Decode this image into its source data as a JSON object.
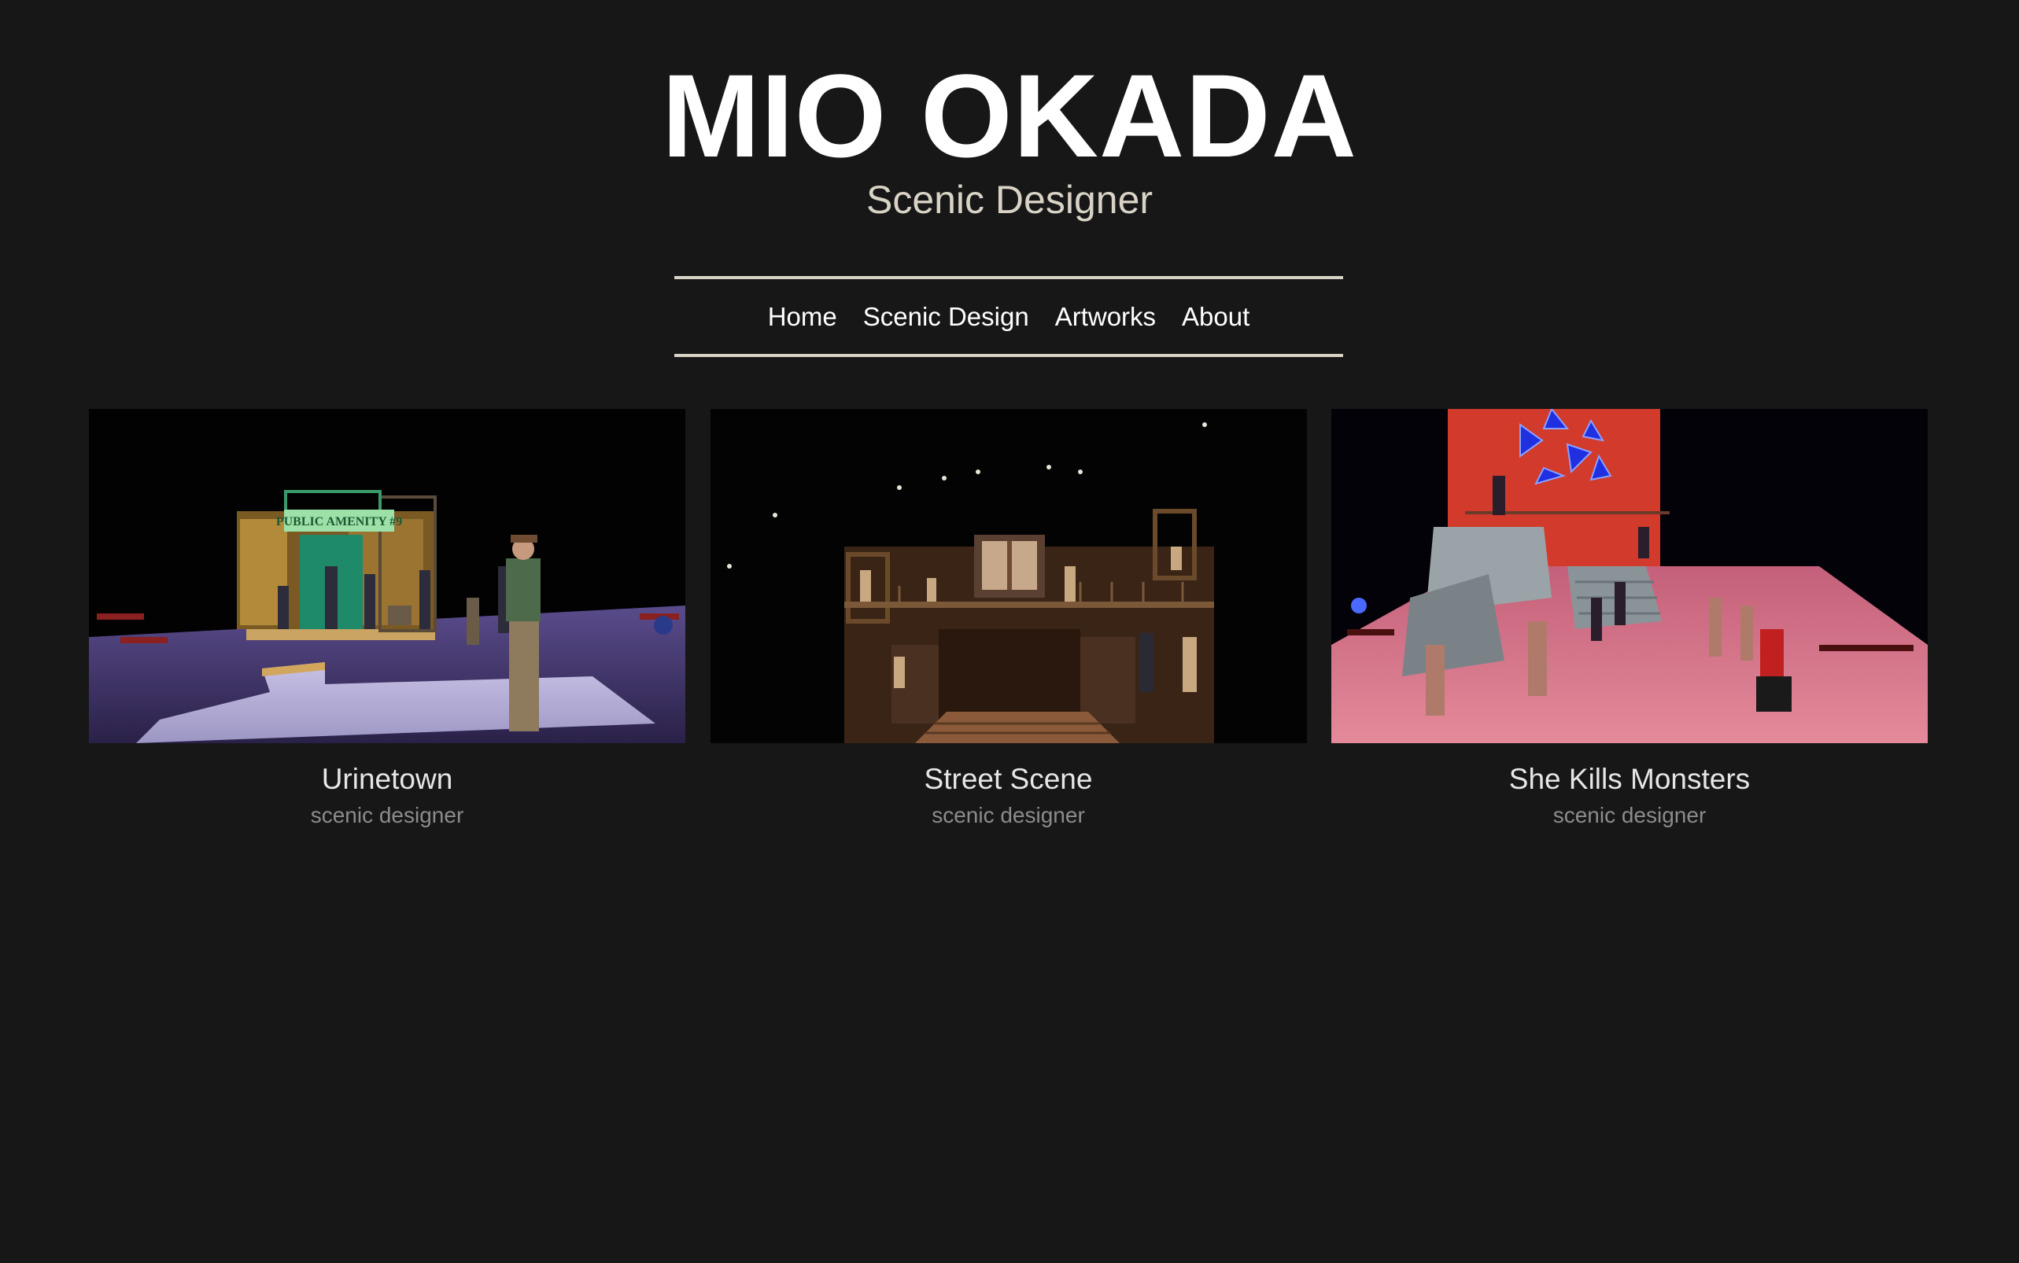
{
  "header": {
    "title": "MIO OKADA",
    "subtitle": "Scenic Designer"
  },
  "nav": {
    "items": [
      {
        "label": "Home"
      },
      {
        "label": "Scenic Design"
      },
      {
        "label": "Artworks"
      },
      {
        "label": "About"
      }
    ]
  },
  "projects": [
    {
      "title": "Urinetown",
      "role": "scenic designer",
      "image": "stage production photo with green sign",
      "sign_text": "PUBLIC AMENITY #9"
    },
    {
      "title": "Street Scene",
      "role": "scenic designer",
      "image": "stage production photo of tenement facade"
    },
    {
      "title": "She Kills Monsters",
      "role": "scenic designer",
      "image": "stage production photo with red backdrop"
    }
  ],
  "colors": {
    "background": "#171717",
    "accent": "#d9d3c6",
    "title": "#ffffff",
    "muted": "#8c8c8c"
  }
}
